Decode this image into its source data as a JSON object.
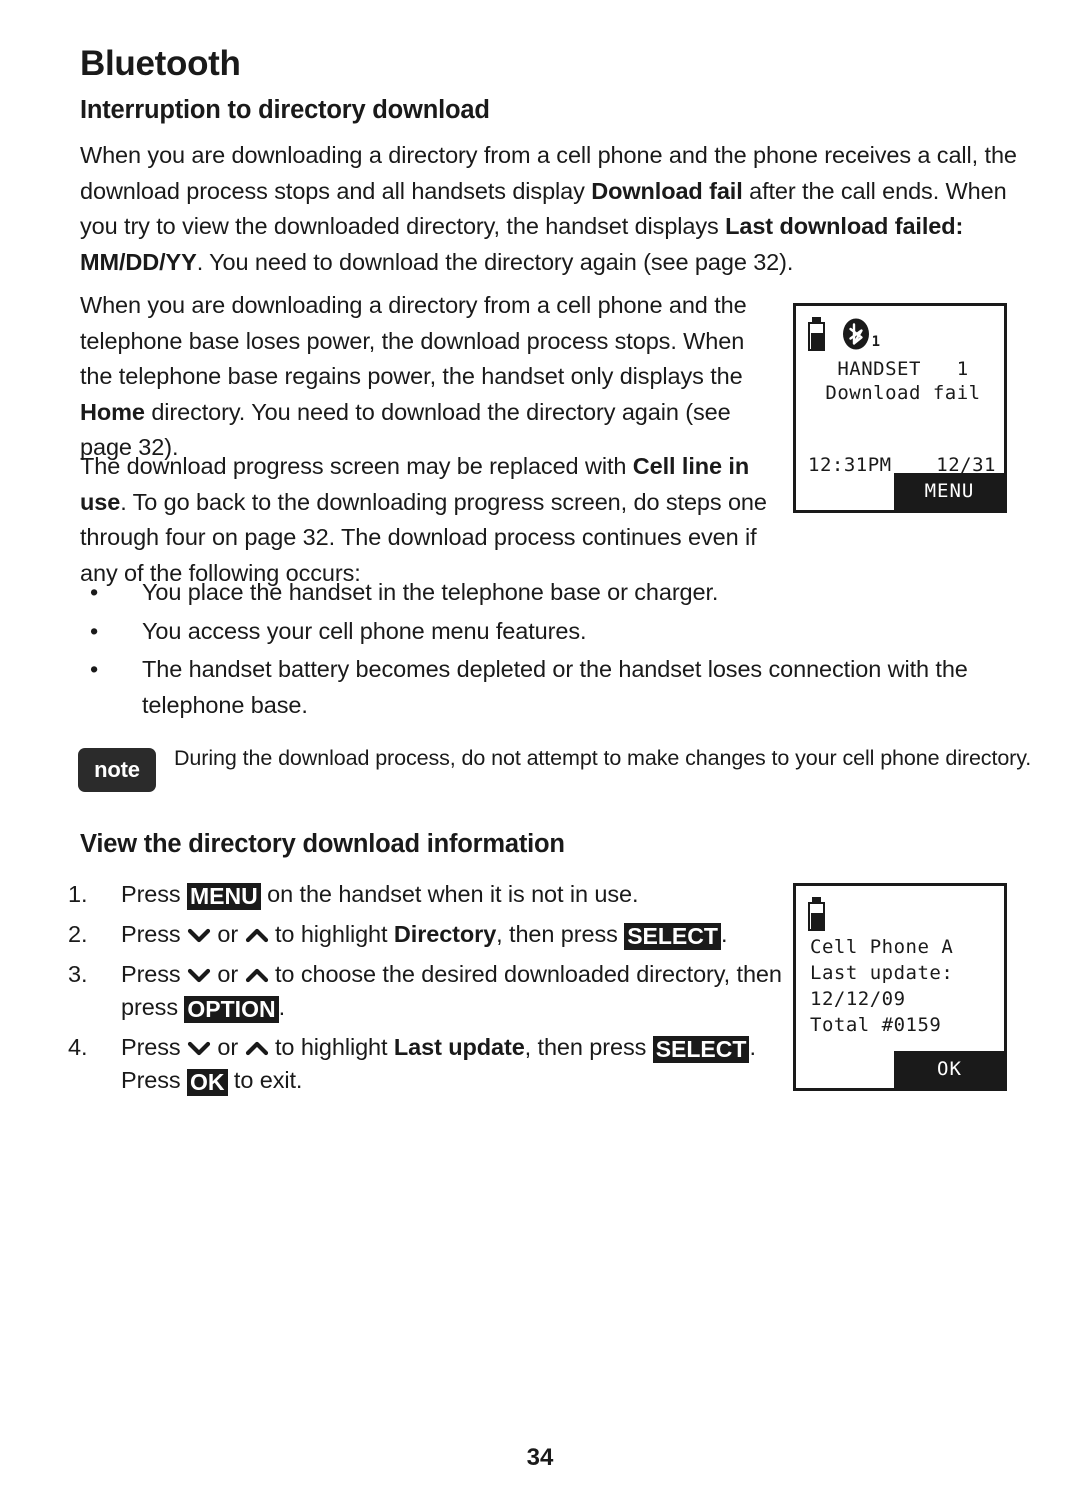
{
  "document": {
    "chapter_title": "Bluetooth",
    "page_number": "34"
  },
  "sections": {
    "interruption": {
      "heading": "Interruption to directory download",
      "paragraph_1": {
        "part_1": "When you are downloading a directory from a cell phone and the phone receives a call, the download process stops and all handsets display ",
        "bold_1": "Download fail",
        "part_2": " after the call ends. When you try to view the downloaded directory, the handset displays ",
        "bold_2": "Last download failed: MM/DD/YY",
        "part_3": ". You need to download the directory again (see page 32)."
      },
      "paragraph_2": {
        "part_1": "When you are downloading a directory from a cell phone and the telephone base loses power, the download process stops. When the telephone base regains power, the handset only displays the ",
        "bold_1": "Home",
        "part_2": " directory. You need to download the directory again (see page 32)."
      },
      "paragraph_3": {
        "part_1": "The download progress screen may be replaced with ",
        "bold_1": "Cell line in use",
        "part_2": ". To go back to the downloading progress screen, do steps one through four on page 32. The download process continues even if any of the following occurs:"
      },
      "bullets": [
        "You place the handset in the telephone base or charger.",
        "You access your cell phone menu features.",
        "The handset battery becomes depleted or the handset loses connection with the telephone base."
      ],
      "bullet_marker": "•",
      "note": {
        "badge": "note",
        "text": "During the download process, do not attempt to make changes to your cell phone directory."
      }
    },
    "view_info": {
      "heading": "View the directory download information",
      "steps": [
        {
          "number": "1.",
          "segments": [
            {
              "type": "text",
              "value": "Press "
            },
            {
              "type": "key",
              "value": "MENU"
            },
            {
              "type": "text",
              "value": " on the handset when it is not in use."
            }
          ]
        },
        {
          "number": "2.",
          "segments": [
            {
              "type": "text",
              "value": "Press "
            },
            {
              "type": "chevron-down",
              "value": ""
            },
            {
              "type": "text",
              "value": " or "
            },
            {
              "type": "chevron-up",
              "value": ""
            },
            {
              "type": "text",
              "value": " to highlight "
            },
            {
              "type": "bold",
              "value": "Directory"
            },
            {
              "type": "text",
              "value": ", then press "
            },
            {
              "type": "key",
              "value": "SELECT"
            },
            {
              "type": "text",
              "value": "."
            }
          ]
        },
        {
          "number": "3.",
          "segments": [
            {
              "type": "text",
              "value": "Press "
            },
            {
              "type": "chevron-down",
              "value": ""
            },
            {
              "type": "text",
              "value": " or "
            },
            {
              "type": "chevron-up",
              "value": ""
            },
            {
              "type": "text",
              "value": " to choose the desired downloaded directory, then press "
            },
            {
              "type": "key",
              "value": "OPTION"
            },
            {
              "type": "text",
              "value": "."
            }
          ]
        },
        {
          "number": "4.",
          "segments": [
            {
              "type": "text",
              "value": "Press "
            },
            {
              "type": "chevron-down",
              "value": ""
            },
            {
              "type": "text",
              "value": " or "
            },
            {
              "type": "chevron-up",
              "value": ""
            },
            {
              "type": "text",
              "value": " to highlight "
            },
            {
              "type": "bold",
              "value": "Last update"
            },
            {
              "type": "text",
              "value": ", then press "
            },
            {
              "type": "key",
              "value": "SELECT"
            },
            {
              "type": "text",
              "value": ". Press "
            },
            {
              "type": "key",
              "value": "OK"
            },
            {
              "type": "text",
              "value": " to exit."
            }
          ]
        }
      ]
    }
  },
  "lcd_screens": [
    {
      "id": "download-fail-screen",
      "icons": [
        "battery-icon",
        "bluetooth-icon"
      ],
      "bluetooth_subscript": "1",
      "line_1": "HANDSET   1",
      "line_2": "Download fail",
      "time": "12:31PM",
      "date": "12/31",
      "softkey": "MENU"
    },
    {
      "id": "last-update-screen",
      "icons": [
        "battery-icon"
      ],
      "line_1": "Cell Phone A",
      "line_2": "Last update:",
      "line_3": "12/12/09",
      "line_4": "Total #0159",
      "softkey": "OK"
    }
  ]
}
